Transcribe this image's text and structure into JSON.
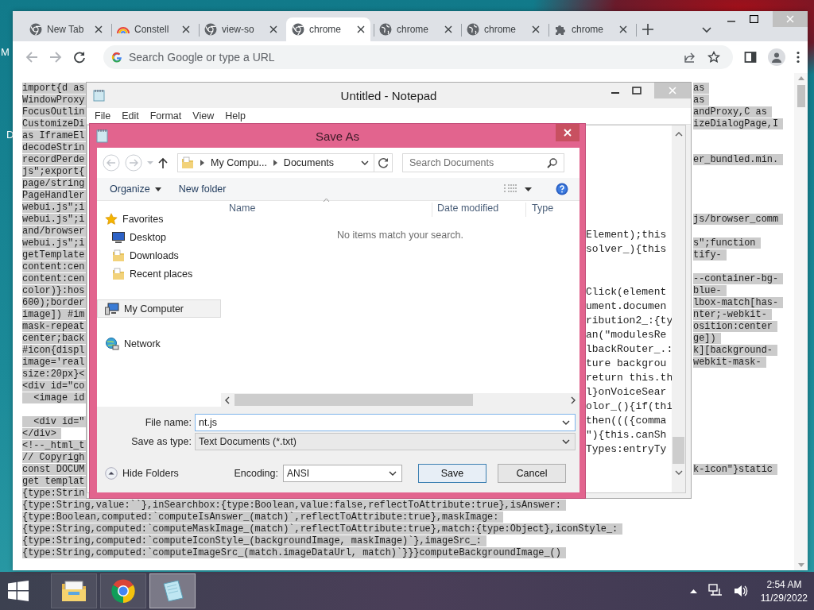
{
  "desktop": {
    "labels": [
      "M",
      "D"
    ]
  },
  "browser": {
    "tabs": [
      {
        "title": "New Tab",
        "kind": "chrome",
        "selected": false
      },
      {
        "title": "Constell",
        "kind": "rainbow",
        "selected": false
      },
      {
        "title": "view-so",
        "kind": "chrome",
        "selected": false
      },
      {
        "title": "chrome",
        "kind": "chrome",
        "selected": true
      },
      {
        "title": "chrome",
        "kind": "globe",
        "selected": false
      },
      {
        "title": "chrome",
        "kind": "globe",
        "selected": false
      },
      {
        "title": "chrome",
        "kind": "puzzle",
        "selected": false
      }
    ],
    "omnibox": {
      "placeholder": "Search Google or type a URL"
    },
    "page_line_groups": [
      [
        {
          "left": "import{d as",
          "right": "as"
        },
        {
          "left": "WindowProxy",
          "right": "as"
        },
        {
          "left": "FocusOutlin",
          "right": "andProxy,C as"
        },
        {
          "left": "CustomizeDi",
          "right": "izeDialogPage,I"
        },
        {
          "left": "as IframeEl"
        },
        {
          "left": "decodeStrin"
        },
        {
          "left": "recordPerde",
          "right": "er_bundled.min."
        },
        {
          "left": "js\";export{"
        },
        {
          "left": "page/string"
        },
        {
          "left": "PageHandler"
        },
        {
          "left": "webui.js\";i"
        },
        {
          "left": "webui.js\";i",
          "right": "js/browser_comm"
        },
        {
          "left": "and/browser"
        },
        {
          "left": "webui.js\";i",
          "right": "s\";function"
        },
        {
          "left": "getTemplate",
          "right": "tify-"
        },
        {
          "left": "content:cen"
        },
        {
          "left": "content:cen",
          "right": "--container-bg-"
        },
        {
          "left": "color)}:hos",
          "right": "blue-"
        },
        {
          "left": "600);border",
          "right": "lbox-match[has-"
        },
        {
          "left": "image]) #im",
          "right": "nter;-webkit-"
        },
        {
          "left": "mask-repeat",
          "right": "osition:center"
        },
        {
          "left": "center;back",
          "right": "ge])"
        },
        {
          "left": "#icon{displ",
          "right": "k][background-"
        },
        {
          "left": "image='real",
          "right": "webkit-mask-"
        },
        {
          "left": "size:20px}<"
        },
        {
          "left": "<div id=\"co"
        },
        {
          "left": "  <image id"
        }
      ],
      [
        {
          "left": "  <div id=\""
        },
        {
          "left": "</div>"
        },
        {
          "left": "<!--_html_t"
        },
        {
          "left": "// Copyrigh"
        },
        {
          "left": "const DOCUM",
          "right": "k-icon\"}static"
        },
        {
          "left": "get templat"
        },
        {
          "left": "{type:Strin"
        },
        {
          "left": "{type:String,value:``},inSearchbox:{type:Boolean,value:false,reflectToAttribute:true},isAnswer:"
        },
        {
          "left": "{type:Boolean,computed:`computeIsAnswer_(match)`,reflectToAttribute:true},maskImage:"
        },
        {
          "left": "{type:String,computed:`computeMaskImage_(match)`,reflectToAttribute:true},match:{type:Object},iconStyle_:"
        },
        {
          "left": "{type:String,computed:`computeIconStyle_(backgroundImage, maskImage)`},imageSrc_:"
        },
        {
          "left": "{type:String,computed:`computeImageSrc_(match.imageDataUrl, match)`}}}computeBackgroundImage_()"
        }
      ]
    ]
  },
  "notepad": {
    "title": "Untitled - Notepad",
    "menu": [
      "File",
      "Edit",
      "Format",
      "View",
      "Help"
    ],
    "line_groups": [
      [
        "Element);this",
        "solver_){this"
      ],
      [
        "Click(element",
        "ument.documen",
        "ribution2_:{ty",
        "an(\"modulesRe",
        "lbackRouter_.:",
        "ture backgrou",
        "return this.th",
        "l}onVoiceSear",
        "olor_(){if(thi",
        "then((({comma",
        "\"){this.canSh",
        "Types:entryTy"
      ]
    ]
  },
  "save_dialog": {
    "title": "Save As",
    "breadcrumb": [
      "My Compu...",
      "Documents"
    ],
    "search_placeholder": "Search Documents",
    "toolbar": {
      "organize": "Organize",
      "new_folder": "New folder"
    },
    "nav": [
      {
        "label": "Favorites",
        "kind": "star",
        "selected": false,
        "children": [
          {
            "label": "Desktop",
            "kind": "monitor",
            "selected": false
          },
          {
            "label": "Downloads",
            "kind": "folder",
            "selected": false
          },
          {
            "label": "Recent places",
            "kind": "folder",
            "selected": false
          }
        ]
      },
      {
        "label": "My Computer",
        "kind": "computer",
        "selected": true
      },
      {
        "label": "Network",
        "kind": "network",
        "selected": false
      }
    ],
    "columns": [
      "Name",
      "Date modified",
      "Type"
    ],
    "empty_message": "No items match your search.",
    "file_name": {
      "label": "File name:",
      "value": "nt.js"
    },
    "save_as_type": {
      "label": "Save as type:",
      "value": "Text Documents (*.txt)"
    },
    "hide_folders": "Hide Folders",
    "encoding": {
      "label": "Encoding:",
      "value": "ANSI"
    },
    "buttons": [
      {
        "label": "Save",
        "default": true
      },
      {
        "label": "Cancel",
        "default": false
      }
    ]
  },
  "taskbar": {
    "apps": [
      {
        "kind": "explorer",
        "active": false
      },
      {
        "kind": "chrome",
        "active": false
      },
      {
        "kind": "notepad",
        "active": true
      }
    ],
    "clock": {
      "time": "2:54 AM",
      "date": "11/29/2022"
    }
  }
}
